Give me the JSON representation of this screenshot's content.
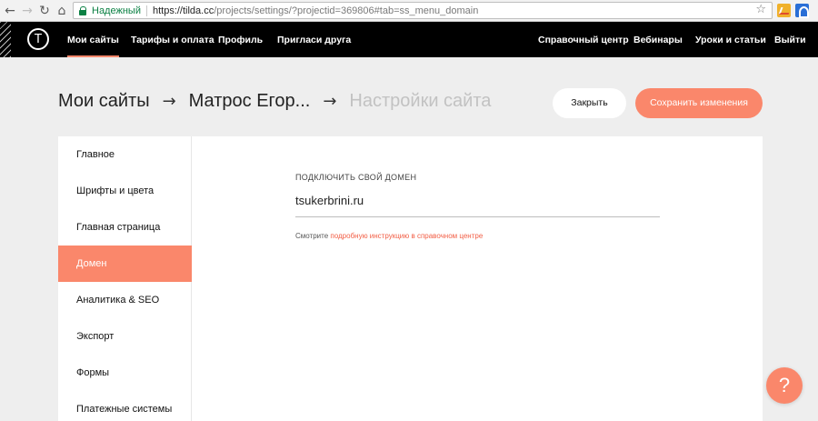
{
  "browser": {
    "back_icon": "←",
    "forward_icon": "→",
    "reload_icon": "↻",
    "home_icon": "⌂",
    "secure_label": "Надежный",
    "url_host": "https://tilda.cc",
    "url_path": "/projects/settings/?projectid=369806#tab=ss_menu_domain",
    "star_icon": "☆"
  },
  "topnav": {
    "logo_letter": "T",
    "left_items": [
      "Мои сайты",
      "Тарифы и оплата",
      "Профиль",
      "Пригласи друга"
    ],
    "right_items": [
      "Справочный центр",
      "Вебинары",
      "Уроки и статьи",
      "Выйти"
    ]
  },
  "header": {
    "crumbs": [
      "Мои сайты",
      "Матрос Егор...",
      "Настройки сайта"
    ],
    "arrow": "→",
    "close_label": "Закрыть",
    "save_label": "Сохранить изменения"
  },
  "sidebar": {
    "items": [
      {
        "label": "Главное"
      },
      {
        "label": "Шрифты и цвета"
      },
      {
        "label": "Главная страница"
      },
      {
        "label": "Домен"
      },
      {
        "label": "Аналитика & SEO"
      },
      {
        "label": "Экспорт"
      },
      {
        "label": "Формы"
      },
      {
        "label": "Платежные системы"
      }
    ],
    "active_index": 3
  },
  "domain": {
    "label": "ПОДКЛЮЧИТЬ СВОЙ ДОМЕН",
    "value": "tsukerbrini.ru",
    "hint_text": "Смотрите",
    "hint_link": "подробную инструкцию в справочном центре"
  },
  "help": {
    "icon": "?"
  },
  "colors": {
    "accent": "#fa876b",
    "nav_bg": "#000000",
    "page_bg": "#eeeeee"
  }
}
